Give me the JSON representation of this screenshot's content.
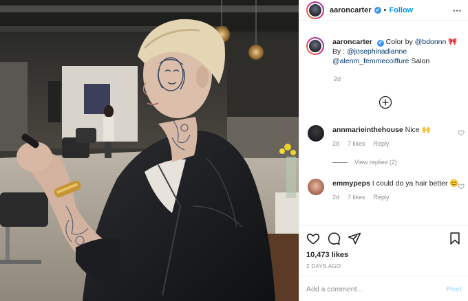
{
  "header": {
    "username": "aaroncarter",
    "verified": "✔",
    "separator": "•",
    "follow_label": "Follow",
    "more_label": "···"
  },
  "caption": {
    "username": "aaroncarter",
    "text_before": "Color by ",
    "mention1": "@bdonnn",
    "emoji": "🎀",
    "by_label": "By : ",
    "mention2": "@josephinadianne",
    "mention3": "@alenm_femmecoiffure",
    "text_after": " Salon",
    "time": "2d"
  },
  "comments": [
    {
      "username": "annmarieinthehouse",
      "text": "Nice 🙌",
      "time": "2d",
      "likes": "7 likes",
      "reply_label": "Reply"
    },
    {
      "username": "emmypeps",
      "text": "I could do ya hair better 😊",
      "time": "2d",
      "likes": "7 likes",
      "reply_label": "Reply"
    }
  ],
  "view_replies": "View replies (2)",
  "likes": "10,473 likes",
  "time_ago": "2 DAYS AGO",
  "add_comment": {
    "placeholder": "Add a comment...",
    "post_label": "Post"
  },
  "colors": {
    "accent": "#0095f6",
    "verified": "#3897f0",
    "muted": "#8e8e8e",
    "post_disabled": "#b3dbff"
  }
}
